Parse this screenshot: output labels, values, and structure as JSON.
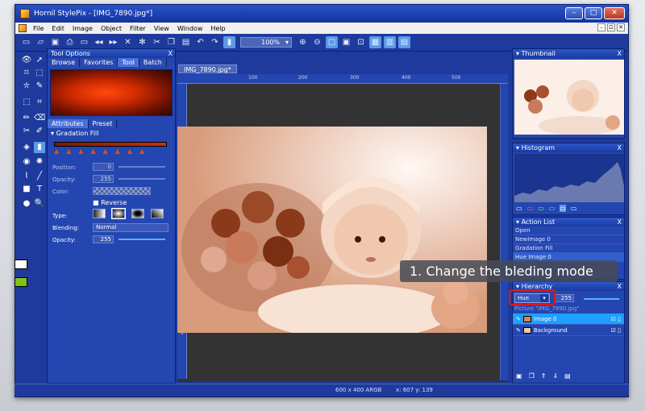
{
  "window": {
    "title": "Hornil StylePix - [IMG_7890.jpg*]",
    "buttons": {
      "min": "–",
      "max": "□",
      "close": "✕"
    }
  },
  "menu": {
    "items": [
      "File",
      "Edit",
      "Image",
      "Object",
      "Filter",
      "View",
      "Window",
      "Help"
    ],
    "mdi": [
      "–",
      "⊡",
      "✕"
    ]
  },
  "toolbar": {
    "zoom": "100%"
  },
  "tool_options": {
    "title": "Tool Options",
    "close": "X",
    "tabs": [
      "Browse",
      "Favorites",
      "Tool",
      "Batch"
    ],
    "active_tab": "Tool",
    "subtabs": [
      "Attributes",
      "Preset"
    ],
    "section": "Gradation Fill",
    "position": {
      "label": "Position:",
      "value": "0"
    },
    "opacity1": {
      "label": "Opacity:",
      "value": "255"
    },
    "color": {
      "label": "Color:"
    },
    "reverse": "Reverse",
    "type_label": "Type:",
    "blending": {
      "label": "Blending:",
      "value": "Normal"
    },
    "opacity2": {
      "label": "Opacity:",
      "value": "255"
    }
  },
  "document": {
    "tab": "IMG_7890.jpg*",
    "ruler_h": [
      "100",
      "200",
      "300",
      "400",
      "500"
    ],
    "ruler_v": [
      "100",
      "200",
      "300",
      "400"
    ]
  },
  "thumbnail": {
    "title": "Thumbnail",
    "close": "X"
  },
  "histogram": {
    "title": "Histogram",
    "close": "X"
  },
  "action_list": {
    "title": "Action List",
    "close": "X",
    "items": [
      "Open",
      "NewImage 0",
      "Gradation Fill",
      "Hue Image 0"
    ]
  },
  "hierarchy": {
    "title": "Hierarchy",
    "close": "X",
    "blend_mode": "Hue",
    "opacity": "255",
    "picture": "Picture \"IMG_7890.jpg\"",
    "layers": [
      {
        "name": "Image 0",
        "selected": true
      },
      {
        "name": "Background",
        "selected": false
      }
    ]
  },
  "status": {
    "size": "600 x 400 ARGB",
    "coords": "x: 607 y: 139"
  },
  "caption": "1. Change the bleding mode"
}
